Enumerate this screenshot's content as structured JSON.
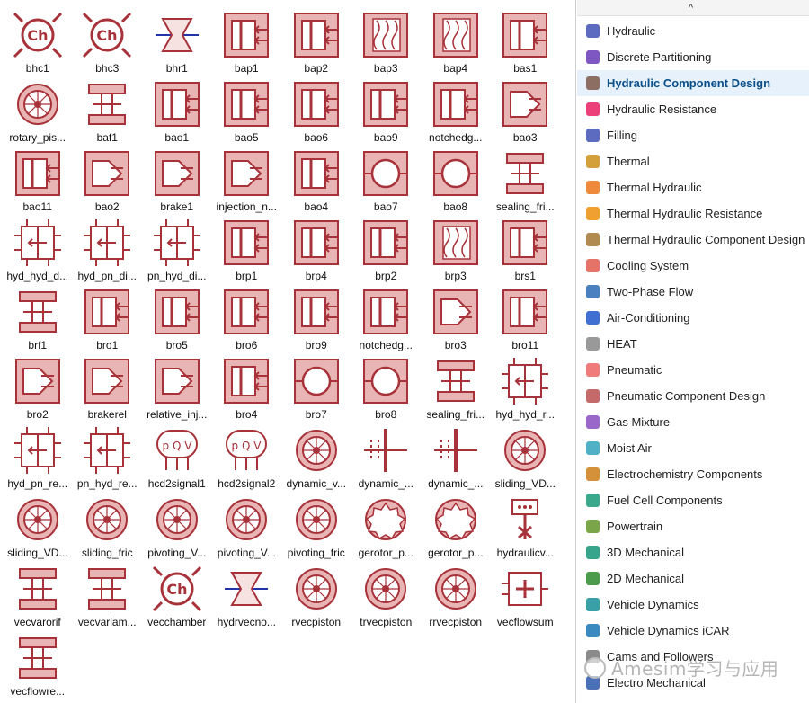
{
  "components": [
    {
      "label": "bhc1",
      "kind": "chamber"
    },
    {
      "label": "bhc3",
      "kind": "chamber"
    },
    {
      "label": "bhr1",
      "kind": "line"
    },
    {
      "label": "bap1",
      "kind": "piston"
    },
    {
      "label": "bap2",
      "kind": "piston"
    },
    {
      "label": "bap3",
      "kind": "spring"
    },
    {
      "label": "bap4",
      "kind": "spring"
    },
    {
      "label": "bas1",
      "kind": "piston"
    },
    {
      "label": "rotary_pis...",
      "kind": "rotary"
    },
    {
      "label": "baf1",
      "kind": "orifice"
    },
    {
      "label": "bao1",
      "kind": "piston"
    },
    {
      "label": "bao5",
      "kind": "piston"
    },
    {
      "label": "bao6",
      "kind": "piston"
    },
    {
      "label": "bao9",
      "kind": "piston"
    },
    {
      "label": "notchedg...",
      "kind": "piston"
    },
    {
      "label": "bao3",
      "kind": "cone"
    },
    {
      "label": "bao11",
      "kind": "piston"
    },
    {
      "label": "bao2",
      "kind": "cone"
    },
    {
      "label": "brake1",
      "kind": "cone"
    },
    {
      "label": "injection_n...",
      "kind": "cone"
    },
    {
      "label": "bao4",
      "kind": "piston"
    },
    {
      "label": "bao7",
      "kind": "ball"
    },
    {
      "label": "bao8",
      "kind": "ball"
    },
    {
      "label": "sealing_fri...",
      "kind": "orifice"
    },
    {
      "label": "hyd_hyd_d...",
      "kind": "diaphragm"
    },
    {
      "label": "hyd_pn_di...",
      "kind": "diaphragm"
    },
    {
      "label": "pn_hyd_di...",
      "kind": "diaphragm"
    },
    {
      "label": "brp1",
      "kind": "piston"
    },
    {
      "label": "brp4",
      "kind": "piston"
    },
    {
      "label": "brp2",
      "kind": "piston"
    },
    {
      "label": "brp3",
      "kind": "spring"
    },
    {
      "label": "brs1",
      "kind": "piston"
    },
    {
      "label": "brf1",
      "kind": "orifice"
    },
    {
      "label": "bro1",
      "kind": "piston"
    },
    {
      "label": "bro5",
      "kind": "piston"
    },
    {
      "label": "bro6",
      "kind": "piston"
    },
    {
      "label": "bro9",
      "kind": "piston"
    },
    {
      "label": "notchedg...",
      "kind": "piston"
    },
    {
      "label": "bro3",
      "kind": "cone"
    },
    {
      "label": "bro11",
      "kind": "piston"
    },
    {
      "label": "bro2",
      "kind": "cone"
    },
    {
      "label": "brakerel",
      "kind": "cone"
    },
    {
      "label": "relative_inj...",
      "kind": "cone"
    },
    {
      "label": "bro4",
      "kind": "piston"
    },
    {
      "label": "bro7",
      "kind": "ball"
    },
    {
      "label": "bro8",
      "kind": "ball"
    },
    {
      "label": "sealing_fri...",
      "kind": "orifice"
    },
    {
      "label": "hyd_hyd_r...",
      "kind": "diaphragm"
    },
    {
      "label": "hyd_pn_re...",
      "kind": "diaphragm"
    },
    {
      "label": "pn_hyd_re...",
      "kind": "diaphragm"
    },
    {
      "label": "hcd2signal1",
      "kind": "sensor"
    },
    {
      "label": "hcd2signal2",
      "kind": "sensor"
    },
    {
      "label": "dynamic_v...",
      "kind": "rotary"
    },
    {
      "label": "dynamic_...",
      "kind": "bar"
    },
    {
      "label": "dynamic_...",
      "kind": "bar"
    },
    {
      "label": "sliding_VD...",
      "kind": "rotary"
    },
    {
      "label": "sliding_VD...",
      "kind": "rotary"
    },
    {
      "label": "sliding_fric",
      "kind": "rotary"
    },
    {
      "label": "pivoting_V...",
      "kind": "rotary"
    },
    {
      "label": "pivoting_V...",
      "kind": "rotary"
    },
    {
      "label": "pivoting_fric",
      "kind": "rotary"
    },
    {
      "label": "gerotor_p...",
      "kind": "gear"
    },
    {
      "label": "gerotor_p...",
      "kind": "gear"
    },
    {
      "label": "hydraulicv...",
      "kind": "valve"
    },
    {
      "label": "vecvarorif",
      "kind": "orifice"
    },
    {
      "label": "vecvarlam...",
      "kind": "orifice"
    },
    {
      "label": "vecchamber",
      "kind": "chamber"
    },
    {
      "label": "hydrvecno...",
      "kind": "line"
    },
    {
      "label": "rvecpiston",
      "kind": "rotary"
    },
    {
      "label": "trvecpiston",
      "kind": "rotary"
    },
    {
      "label": "rrvecpiston",
      "kind": "rotary"
    },
    {
      "label": "vecflowsum",
      "kind": "sum"
    },
    {
      "label": "vecflowre...",
      "kind": "orifice"
    }
  ],
  "categories": [
    {
      "label": "Hydraulic",
      "icon": "hydraulic-icon",
      "color": "#5c6bc0"
    },
    {
      "label": "Discrete Partitioning",
      "icon": "partition-icon",
      "color": "#7e57c2"
    },
    {
      "label": "Hydraulic Component Design",
      "icon": "hcd-icon",
      "color": "#8d6e63",
      "selected": true
    },
    {
      "label": "Hydraulic Resistance",
      "icon": "resistance-icon",
      "color": "#ec407a"
    },
    {
      "label": "Filling",
      "icon": "filling-icon",
      "color": "#5c6bc0"
    },
    {
      "label": "Thermal",
      "icon": "thermal-icon",
      "color": "#d4a03c"
    },
    {
      "label": "Thermal Hydraulic",
      "icon": "thermal-hydraulic-icon",
      "color": "#ef8a3c"
    },
    {
      "label": "Thermal Hydraulic Resistance",
      "icon": "thermal-resistance-icon",
      "color": "#f0a030"
    },
    {
      "label": "Thermal Hydraulic Component Design",
      "icon": "thermal-hcd-icon",
      "color": "#b08a50"
    },
    {
      "label": "Cooling System",
      "icon": "cooling-icon",
      "color": "#e57368"
    },
    {
      "label": "Two-Phase Flow",
      "icon": "two-phase-icon",
      "color": "#4a7fc0"
    },
    {
      "label": "Air-Conditioning",
      "icon": "snowflake-icon",
      "color": "#3f6fd0"
    },
    {
      "label": "HEAT",
      "icon": "heat-icon",
      "color": "#999999"
    },
    {
      "label": "Pneumatic",
      "icon": "pneumatic-icon",
      "color": "#ef7b7b"
    },
    {
      "label": "Pneumatic Component Design",
      "icon": "pcd-icon",
      "color": "#c46a6a"
    },
    {
      "label": "Gas Mixture",
      "icon": "gas-mixture-icon",
      "color": "#9a68c9"
    },
    {
      "label": "Moist Air",
      "icon": "moist-air-icon",
      "color": "#4fb0c6"
    },
    {
      "label": "Electrochemistry Components",
      "icon": "electrochem-icon",
      "color": "#d5913a"
    },
    {
      "label": "Fuel Cell Components",
      "icon": "fuel-cell-icon",
      "color": "#3aa88a"
    },
    {
      "label": "Powertrain",
      "icon": "powertrain-icon",
      "color": "#7aa548"
    },
    {
      "label": "3D Mechanical",
      "icon": "mech3d-icon",
      "color": "#36a58b"
    },
    {
      "label": "2D Mechanical",
      "icon": "mech2d-icon",
      "color": "#4c9a4c"
    },
    {
      "label": "Vehicle Dynamics",
      "icon": "vehicle-icon",
      "color": "#3aa0a8"
    },
    {
      "label": "Vehicle Dynamics iCAR",
      "icon": "icar-icon",
      "color": "#3a8ac0"
    },
    {
      "label": "Cams and Followers",
      "icon": "cams-icon",
      "color": "#8a8a8a"
    },
    {
      "label": "Electro Mechanical",
      "icon": "electro-mech-icon",
      "color": "#4a70b8"
    }
  ],
  "watermark": {
    "text": "Amesim学习与应用"
  },
  "scroll": {
    "arrow": "^"
  }
}
